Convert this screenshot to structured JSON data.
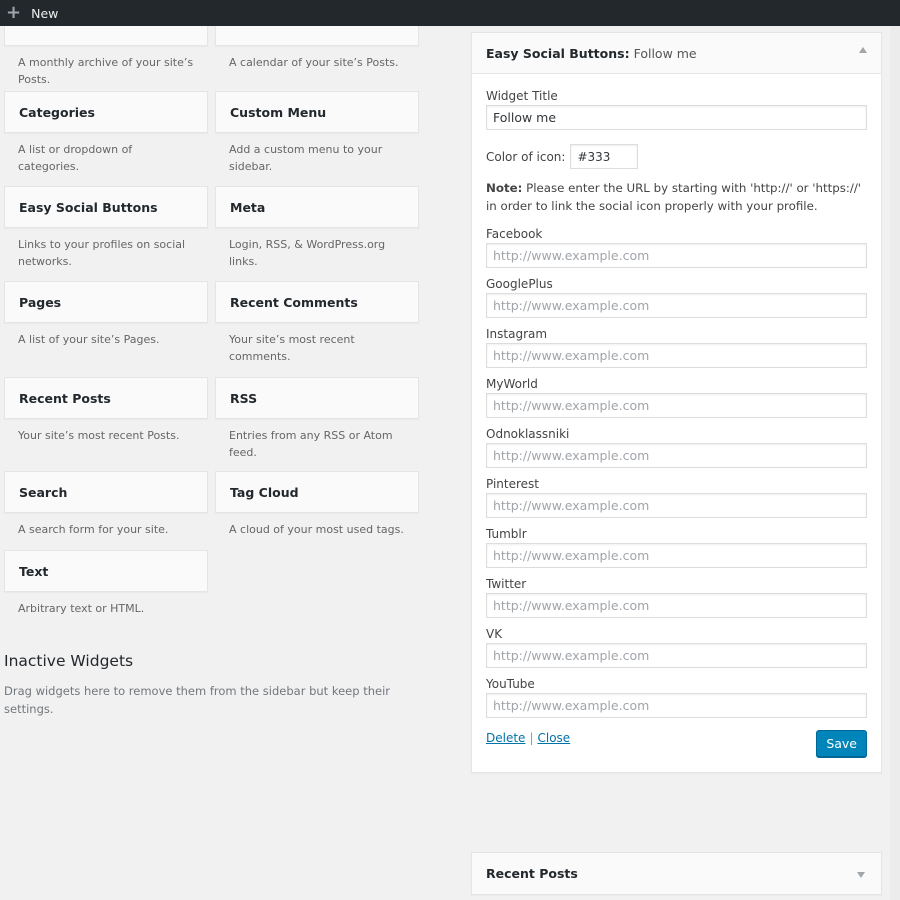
{
  "adminbar": {
    "new_label": "New",
    "plus_icon": "plus-icon"
  },
  "available_widgets": [
    {
      "name": "",
      "desc": "A monthly archive of your site’s Posts."
    },
    {
      "name": "",
      "desc": "A calendar of your site’s Posts."
    },
    {
      "name": "Categories",
      "desc": "A list or dropdown of categories."
    },
    {
      "name": "Custom Menu",
      "desc": "Add a custom menu to your sidebar."
    },
    {
      "name": "Easy Social Buttons",
      "desc": "Links to your profiles on social networks."
    },
    {
      "name": "Meta",
      "desc": "Login, RSS, & WordPress.org links."
    },
    {
      "name": "Pages",
      "desc": "A list of your site’s Pages."
    },
    {
      "name": "Recent Comments",
      "desc": "Your site’s most recent comments."
    },
    {
      "name": "Recent Posts",
      "desc": "Your site’s most recent Posts."
    },
    {
      "name": "RSS",
      "desc": "Entries from any RSS or Atom feed."
    },
    {
      "name": "Search",
      "desc": "A search form for your site."
    },
    {
      "name": "Tag Cloud",
      "desc": "A cloud of your most used tags."
    },
    {
      "name": "Text",
      "desc": "Arbitrary text or HTML."
    }
  ],
  "inactive": {
    "title": "Inactive Widgets",
    "desc": "Drag widgets here to remove them from the sidebar but keep their settings."
  },
  "widget_panel": {
    "title_strong": "Easy Social Buttons:",
    "title_instance": "Follow me",
    "widget_title_label": "Widget Title",
    "widget_title_value": "Follow me",
    "color_label": "Color of icon:",
    "color_value": "#333",
    "note_strong": "Note:",
    "note_text": " Please enter the URL by starting with 'http://' or 'https://' in order to link the social icon properly with your profile.",
    "social_fields": [
      {
        "label": "Facebook",
        "placeholder": "http://www.example.com",
        "value": ""
      },
      {
        "label": "GooglePlus",
        "placeholder": "http://www.example.com",
        "value": ""
      },
      {
        "label": "Instagram",
        "placeholder": "http://www.example.com",
        "value": ""
      },
      {
        "label": "MyWorld",
        "placeholder": "http://www.example.com",
        "value": ""
      },
      {
        "label": "Odnoklassniki",
        "placeholder": "http://www.example.com",
        "value": ""
      },
      {
        "label": "Pinterest",
        "placeholder": "http://www.example.com",
        "value": ""
      },
      {
        "label": "Tumblr",
        "placeholder": "http://www.example.com",
        "value": ""
      },
      {
        "label": "Twitter",
        "placeholder": "http://www.example.com",
        "value": ""
      },
      {
        "label": "VK",
        "placeholder": "http://www.example.com",
        "value": ""
      },
      {
        "label": "YouTube",
        "placeholder": "http://www.example.com",
        "value": ""
      }
    ],
    "delete_label": "Delete",
    "separator": "|",
    "close_label": "Close",
    "save_label": "Save"
  },
  "collapsed_widget": {
    "title": "Recent Posts"
  },
  "colors": {
    "accent": "#0085ba",
    "link": "#0073aa",
    "adminbar": "#23282d",
    "background": "#f1f1f1"
  }
}
